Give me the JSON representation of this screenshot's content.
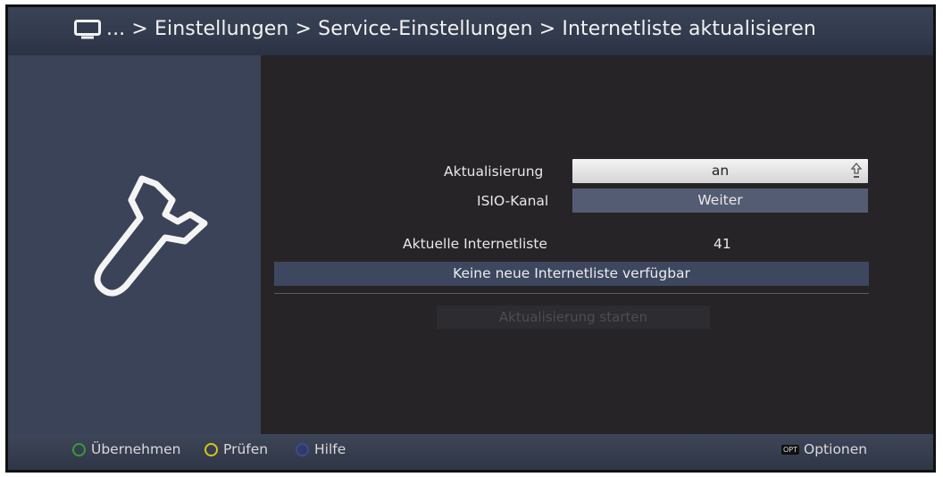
{
  "header": {
    "breadcrumb": "... > Einstellungen > Service-Einstellungen > Internetliste aktualisieren",
    "icon": "tv-icon"
  },
  "left_panel": {
    "icon": "wrench-icon"
  },
  "settings": {
    "aktualisierung": {
      "label": "Aktualisierung",
      "value": "an"
    },
    "isio_kanal": {
      "label": "ISIO-Kanal",
      "value": "Weiter"
    },
    "aktuelle_liste": {
      "label": "Aktuelle Internetliste",
      "value": "41"
    }
  },
  "status_message": "Keine neue Internetliste verfügbar",
  "start_button": {
    "label": "Aktualisierung starten",
    "enabled": false
  },
  "footer": {
    "buttons": [
      {
        "label": "Übernehmen",
        "color": "#3c9a3a"
      },
      {
        "label": "Prüfen",
        "color": "#d8c41c"
      },
      {
        "label": "Hilfe",
        "color": "#3b4c8c"
      }
    ],
    "options": {
      "badge": "OPT",
      "label": "Optionen"
    }
  },
  "colors": {
    "title_bar": "#323a4d",
    "left_panel": "#3a4358",
    "background": "#262426",
    "highlight": "#545c73"
  }
}
